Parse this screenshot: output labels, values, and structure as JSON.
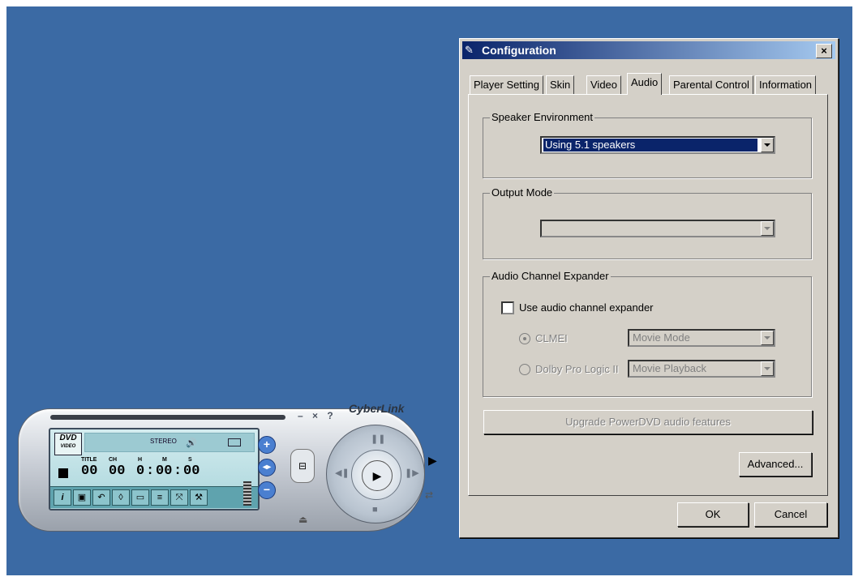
{
  "player": {
    "brand": "CyberLink",
    "window_controls": "– × ?",
    "logo_top": "DVD",
    "logo_bottom": "VIDEO",
    "stereo_label": "STEREO",
    "time_labels": [
      "TITLE",
      "CH",
      "H",
      "M",
      "S"
    ],
    "time_values": [
      "00",
      "00",
      "0",
      "00",
      "00"
    ],
    "separators": [
      ":",
      ":"
    ]
  },
  "dialog": {
    "title": "Configuration",
    "close_label": "×",
    "tabs": [
      {
        "label": "Player Setting",
        "active": false
      },
      {
        "label": "Skin",
        "active": false
      },
      {
        "label": "Video",
        "active": false
      },
      {
        "label": "Audio",
        "active": true
      },
      {
        "label": "Parental Control",
        "active": false
      },
      {
        "label": "Information",
        "active": false
      }
    ],
    "speaker_environment": {
      "label": "Speaker Environment",
      "value": "Using 5.1 speakers"
    },
    "output_mode": {
      "label": "Output Mode",
      "value": ""
    },
    "audio_channel_expander": {
      "label": "Audio Channel Expander",
      "checkbox_label": "Use audio channel expander",
      "checked": false,
      "options": [
        {
          "label": "CLMEI",
          "selected": true,
          "mode": "Movie Mode"
        },
        {
          "label": "Dolby Pro Logic II",
          "selected": false,
          "mode": "Movie Playback"
        }
      ]
    },
    "upgrade_label": "Upgrade PowerDVD audio features",
    "advanced_label": "Advanced...",
    "ok_label": "OK",
    "cancel_label": "Cancel"
  }
}
